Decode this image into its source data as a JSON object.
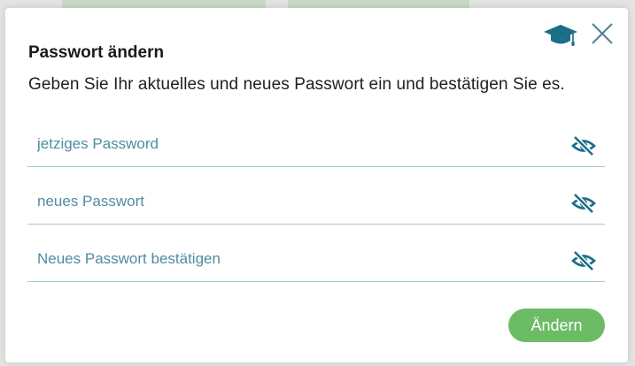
{
  "colors": {
    "accent": "#1b6e88",
    "primary_button": "#6cbc66",
    "placeholder": "#4e8ca2",
    "field_underline": "#a7c9d2"
  },
  "dialog": {
    "title": "Passwort ändern",
    "subtitle": "Geben Sie Ihr aktuelles und neues Passwort ein und bestätigen Sie es.",
    "help_icon": "graduation-cap-icon",
    "close_icon": "close-icon",
    "fields": [
      {
        "placeholder": "jetziges Password",
        "value": "",
        "toggle_icon": "eye-slash-icon"
      },
      {
        "placeholder": "neues Passwort",
        "value": "",
        "toggle_icon": "eye-slash-icon"
      },
      {
        "placeholder": "Neues Passwort bestätigen",
        "value": "",
        "toggle_icon": "eye-slash-icon"
      }
    ],
    "submit_label": "Ändern"
  }
}
